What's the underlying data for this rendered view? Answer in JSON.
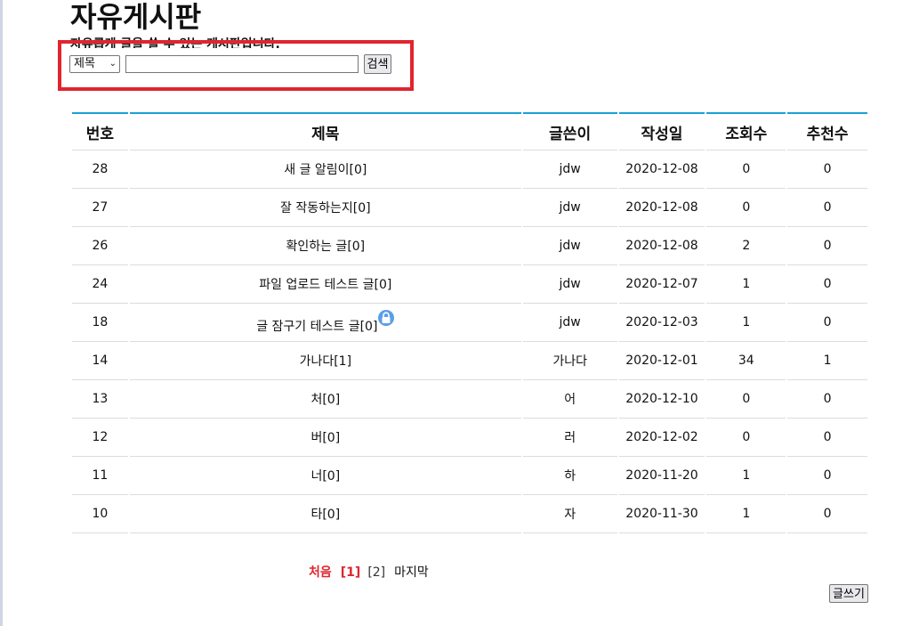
{
  "header": {
    "title": "자유게시판",
    "description": "자유롭게 글을 쓸 수 있는 게시판입니다."
  },
  "search": {
    "field_selected": "제목",
    "query_value": "",
    "button_label": "검색"
  },
  "colors": {
    "accent_line": "#1aa0d6",
    "highlight": "#e0252f",
    "lock_icon": "#5a9ee8"
  },
  "table": {
    "headers": {
      "no": "번호",
      "title": "제목",
      "author": "글쓴이",
      "date": "작성일",
      "views": "조회수",
      "likes": "추천수"
    },
    "rows": [
      {
        "no": "28",
        "title": "새 글 알림이",
        "comments": "[0]",
        "author": "jdw",
        "date": "2020-12-08",
        "views": "0",
        "likes": "0",
        "locked": false
      },
      {
        "no": "27",
        "title": "잘 작동하는지",
        "comments": "[0]",
        "author": "jdw",
        "date": "2020-12-08",
        "views": "0",
        "likes": "0",
        "locked": false
      },
      {
        "no": "26",
        "title": "확인하는 글",
        "comments": "[0]",
        "author": "jdw",
        "date": "2020-12-08",
        "views": "2",
        "likes": "0",
        "locked": false
      },
      {
        "no": "24",
        "title": "파일 업로드 테스트 글",
        "comments": "[0]",
        "author": "jdw",
        "date": "2020-12-07",
        "views": "1",
        "likes": "0",
        "locked": false
      },
      {
        "no": "18",
        "title": "글 잠구기 테스트 글",
        "comments": "[0]",
        "author": "jdw",
        "date": "2020-12-03",
        "views": "1",
        "likes": "0",
        "locked": true
      },
      {
        "no": "14",
        "title": "가나다",
        "comments": "[1]",
        "author": "가나다",
        "date": "2020-12-01",
        "views": "34",
        "likes": "1",
        "locked": false
      },
      {
        "no": "13",
        "title": "처",
        "comments": "[0]",
        "author": "어",
        "date": "2020-12-10",
        "views": "0",
        "likes": "0",
        "locked": false
      },
      {
        "no": "12",
        "title": "버",
        "comments": "[0]",
        "author": "러",
        "date": "2020-12-02",
        "views": "0",
        "likes": "0",
        "locked": false
      },
      {
        "no": "11",
        "title": "너",
        "comments": "[0]",
        "author": "하",
        "date": "2020-11-20",
        "views": "1",
        "likes": "0",
        "locked": false
      },
      {
        "no": "10",
        "title": "타",
        "comments": "[0]",
        "author": "자",
        "date": "2020-11-30",
        "views": "1",
        "likes": "0",
        "locked": false
      }
    ]
  },
  "pagination": {
    "first": "처음",
    "pages": [
      "[1]",
      "[2]"
    ],
    "current": "[1]",
    "last": "마지막"
  },
  "actions": {
    "write_label": "글쓰기"
  }
}
